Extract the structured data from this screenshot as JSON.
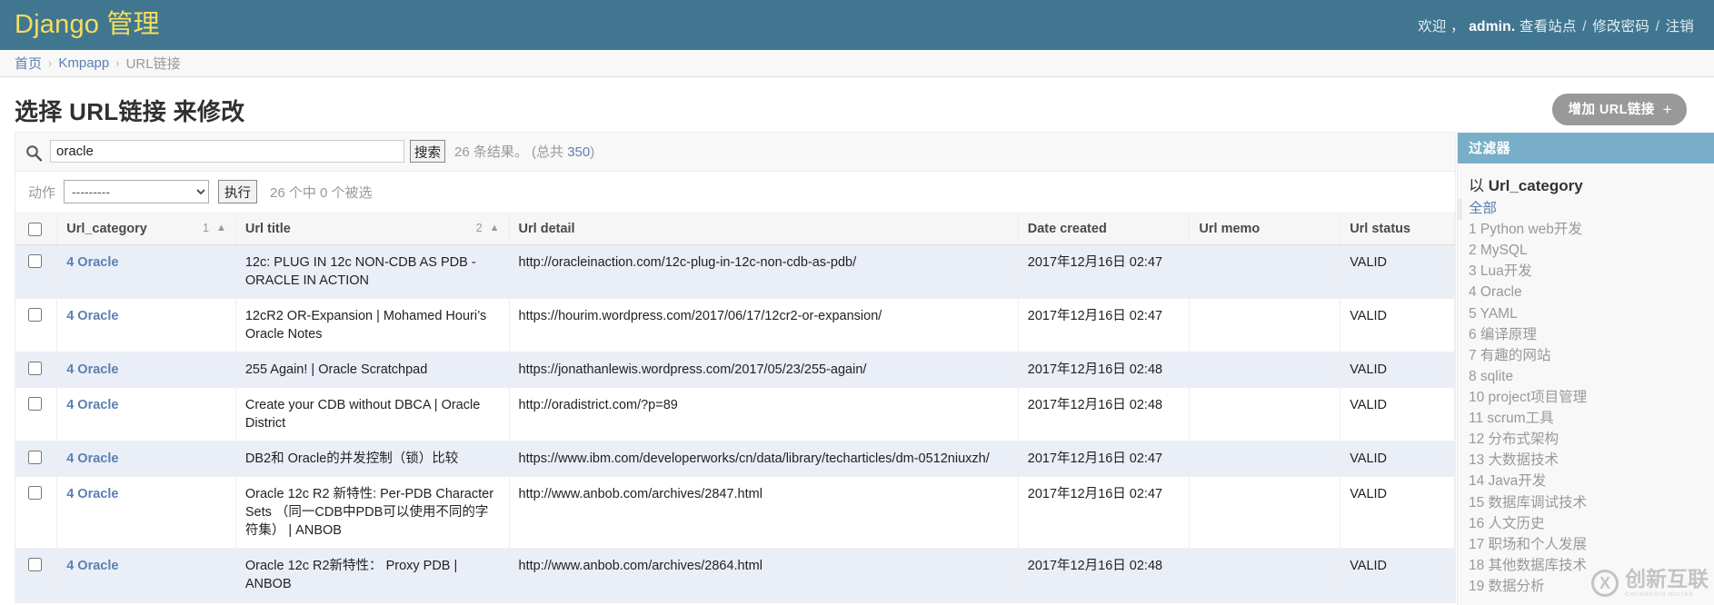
{
  "header": {
    "site_title": "Django 管理",
    "welcome_prefix": "欢迎 ，",
    "username": "admin.",
    "view_site": "查看站点",
    "change_password": "修改密码",
    "logout": "注销",
    "separator": "/",
    "bg_color": "#417690",
    "title_color": "#f5dd5d"
  },
  "breadcrumbs": {
    "home": "首页",
    "app": "Kmpapp",
    "model": "URL链接",
    "separator": "›"
  },
  "page": {
    "title": "选择 URL链接 来修改",
    "add_button": "增加 URL链接",
    "add_button_plus": "+"
  },
  "search": {
    "icon": "search-icon",
    "value": "oracle",
    "placeholder": "",
    "submit_label": "搜索",
    "result_count_text": "26 条结果。",
    "total_text_prefix": "(总共 ",
    "total_count": "350",
    "total_text_suffix": ")"
  },
  "actions": {
    "label": "动作",
    "selected_option": "---------",
    "options": [
      "---------"
    ],
    "go_label": "执行",
    "counter": "26 个中 0 个被选"
  },
  "table": {
    "columns": [
      {
        "key": "checkbox",
        "label": "",
        "sort_priority": "",
        "sort_arrow": ""
      },
      {
        "key": "category",
        "label": "Url_category",
        "sort_priority": "1",
        "sort_arrow": "▲"
      },
      {
        "key": "title",
        "label": "Url title",
        "sort_priority": "2",
        "sort_arrow": "▲"
      },
      {
        "key": "detail",
        "label": "Url detail",
        "sort_priority": "",
        "sort_arrow": ""
      },
      {
        "key": "date",
        "label": "Date created",
        "sort_priority": "",
        "sort_arrow": ""
      },
      {
        "key": "memo",
        "label": "Url memo",
        "sort_priority": "",
        "sort_arrow": ""
      },
      {
        "key": "status",
        "label": "Url status",
        "sort_priority": "",
        "sort_arrow": ""
      }
    ],
    "rows": [
      {
        "category": "4 Oracle",
        "title": "12c: PLUG IN 12c NON-CDB AS PDB - ORACLE IN ACTION",
        "detail": "http://oracleinaction.com/12c-plug-in-12c-non-cdb-as-pdb/",
        "date": "2017年12月16日 02:47",
        "memo": "",
        "status": "VALID"
      },
      {
        "category": "4 Oracle",
        "title": "12cR2 OR-Expansion | Mohamed Houri’s Oracle Notes",
        "detail": "https://hourim.wordpress.com/2017/06/17/12cr2-or-expansion/",
        "date": "2017年12月16日 02:47",
        "memo": "",
        "status": "VALID"
      },
      {
        "category": "4 Oracle",
        "title": "255 Again! | Oracle Scratchpad",
        "detail": "https://jonathanlewis.wordpress.com/2017/05/23/255-again/",
        "date": "2017年12月16日 02:48",
        "memo": "",
        "status": "VALID"
      },
      {
        "category": "4 Oracle",
        "title": "Create your CDB without DBCA | Oracle District",
        "detail": "http://oradistrict.com/?p=89",
        "date": "2017年12月16日 02:48",
        "memo": "",
        "status": "VALID"
      },
      {
        "category": "4 Oracle",
        "title": "DB2和 Oracle的并发控制（锁）比较",
        "detail": "https://www.ibm.com/developerworks/cn/data/library/techarticles/dm-0512niuxzh/",
        "date": "2017年12月16日 02:47",
        "memo": "",
        "status": "VALID"
      },
      {
        "category": "4 Oracle",
        "title": "Oracle 12c R2 新特性: Per-PDB Character Sets （同一CDB中PDB可以使用不同的字符集） | ANBOB",
        "detail": "http://www.anbob.com/archives/2847.html",
        "date": "2017年12月16日 02:47",
        "memo": "",
        "status": "VALID"
      },
      {
        "category": "4 Oracle",
        "title": "Oracle 12c R2新特性： Proxy PDB | ANBOB",
        "detail": "http://www.anbob.com/archives/2864.html",
        "date": "2017年12月16日 02:48",
        "memo": "",
        "status": "VALID"
      }
    ]
  },
  "filter": {
    "heading": "过滤器",
    "group_prefix": "以",
    "group_field": "Url_category",
    "items": [
      {
        "label": "全部",
        "selected": true
      },
      {
        "label": "1 Python web开发",
        "selected": false
      },
      {
        "label": "2 MySQL",
        "selected": false
      },
      {
        "label": "3 Lua开发",
        "selected": false
      },
      {
        "label": "4 Oracle",
        "selected": false
      },
      {
        "label": "5 YAML",
        "selected": false
      },
      {
        "label": "6 编译原理",
        "selected": false
      },
      {
        "label": "7 有趣的网站",
        "selected": false
      },
      {
        "label": "8 sqlite",
        "selected": false
      },
      {
        "label": "10 project项目管理",
        "selected": false
      },
      {
        "label": "11 scrum工具",
        "selected": false
      },
      {
        "label": "12 分布式架构",
        "selected": false
      },
      {
        "label": "13 大数据技术",
        "selected": false
      },
      {
        "label": "14 Java开发",
        "selected": false
      },
      {
        "label": "15 数据库调试技术",
        "selected": false
      },
      {
        "label": "16 人文历史",
        "selected": false
      },
      {
        "label": "17 职场和个人发展",
        "selected": false
      },
      {
        "label": "18 其他数据库技术",
        "selected": false
      },
      {
        "label": "19 数据分析",
        "selected": false
      }
    ]
  },
  "watermark": {
    "mark": "X",
    "text": "创新互联",
    "subtext": "CHUANGXIN HULIAN"
  }
}
